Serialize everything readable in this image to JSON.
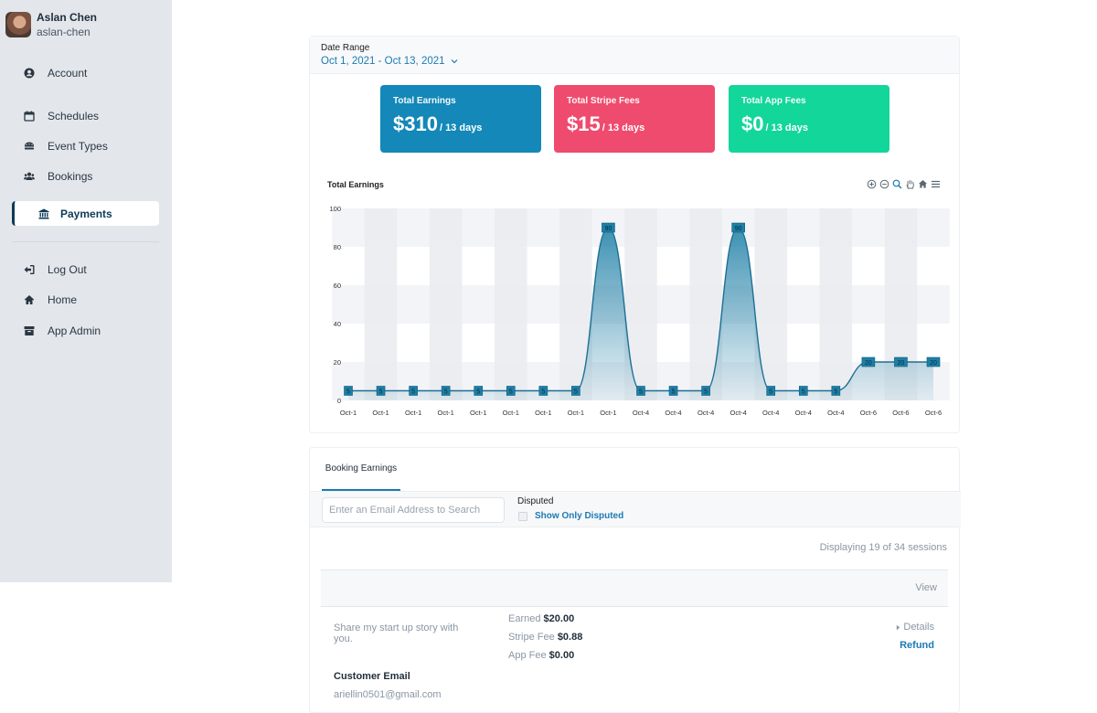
{
  "profile": {
    "name": "Aslan Chen",
    "handle": "aslan-chen"
  },
  "sidebar": {
    "items": [
      {
        "label": "Account",
        "icon": "user-circle-icon"
      },
      {
        "label": "Schedules",
        "icon": "calendar-icon"
      },
      {
        "label": "Event Types",
        "icon": "event-types-icon"
      },
      {
        "label": "Bookings",
        "icon": "users-icon"
      },
      {
        "label": "Payments",
        "icon": "bank-icon",
        "active": true
      },
      {
        "label": "Log Out",
        "icon": "logout-icon"
      },
      {
        "label": "Home",
        "icon": "home-icon"
      },
      {
        "label": "App Admin",
        "icon": "archive-icon"
      }
    ]
  },
  "date_range": {
    "label": "Date Range",
    "value": "Oct 1, 2021 - Oct 13, 2021"
  },
  "cards": [
    {
      "title": "Total Earnings",
      "amount": "$310",
      "suffix": "/ 13 days",
      "color": "#1488b8"
    },
    {
      "title": "Total Stripe Fees",
      "amount": "$15",
      "suffix": "/ 13 days",
      "color": "#ef4b6e"
    },
    {
      "title": "Total App Fees",
      "amount": "$0",
      "suffix": "/ 13 days",
      "color": "#13d69a"
    }
  ],
  "chart_data": {
    "type": "area",
    "title": "Total Earnings",
    "categories": [
      "Oct-1",
      "Oct-1",
      "Oct-1",
      "Oct-1",
      "Oct-1",
      "Oct-1",
      "Oct-1",
      "Oct-1",
      "Oct-1",
      "Oct-4",
      "Oct-4",
      "Oct-4",
      "Oct-4",
      "Oct-4",
      "Oct-4",
      "Oct-4",
      "Oct-6",
      "Oct-6",
      "Oct-6"
    ],
    "values": [
      5,
      5,
      5,
      5,
      5,
      5,
      5,
      5,
      90,
      5,
      5,
      5,
      90,
      5,
      5,
      5,
      20,
      20,
      20
    ],
    "ylim": [
      0,
      100
    ],
    "yticks": [
      0,
      20,
      40,
      60,
      80,
      100
    ],
    "grid": true,
    "line_color": "#1d6f96",
    "label_bg": "#1d7fa6"
  },
  "chart_tools": [
    "zoom-in-icon",
    "zoom-out-icon",
    "zoom-select-icon",
    "pan-hand-icon",
    "reset-home-icon",
    "menu-icon"
  ],
  "bookings": {
    "tab": "Booking Earnings",
    "search_placeholder": "Enter an Email Address to Search",
    "disputed_label": "Disputed",
    "disputed_toggle": "Show Only Disputed",
    "displaying": "Displaying 19 of 34 sessions",
    "view_header": "View",
    "row": {
      "title": "Share my start up story with you.",
      "earned_label": "Earned",
      "earned_value": "$20.00",
      "stripe_label": "Stripe Fee",
      "stripe_value": "$0.88",
      "app_label": "App Fee",
      "app_value": "$0.00",
      "details": "Details",
      "refund": "Refund",
      "customer_email_label": "Customer Email",
      "customer_email": "ariellin0501@gmail.com"
    }
  }
}
